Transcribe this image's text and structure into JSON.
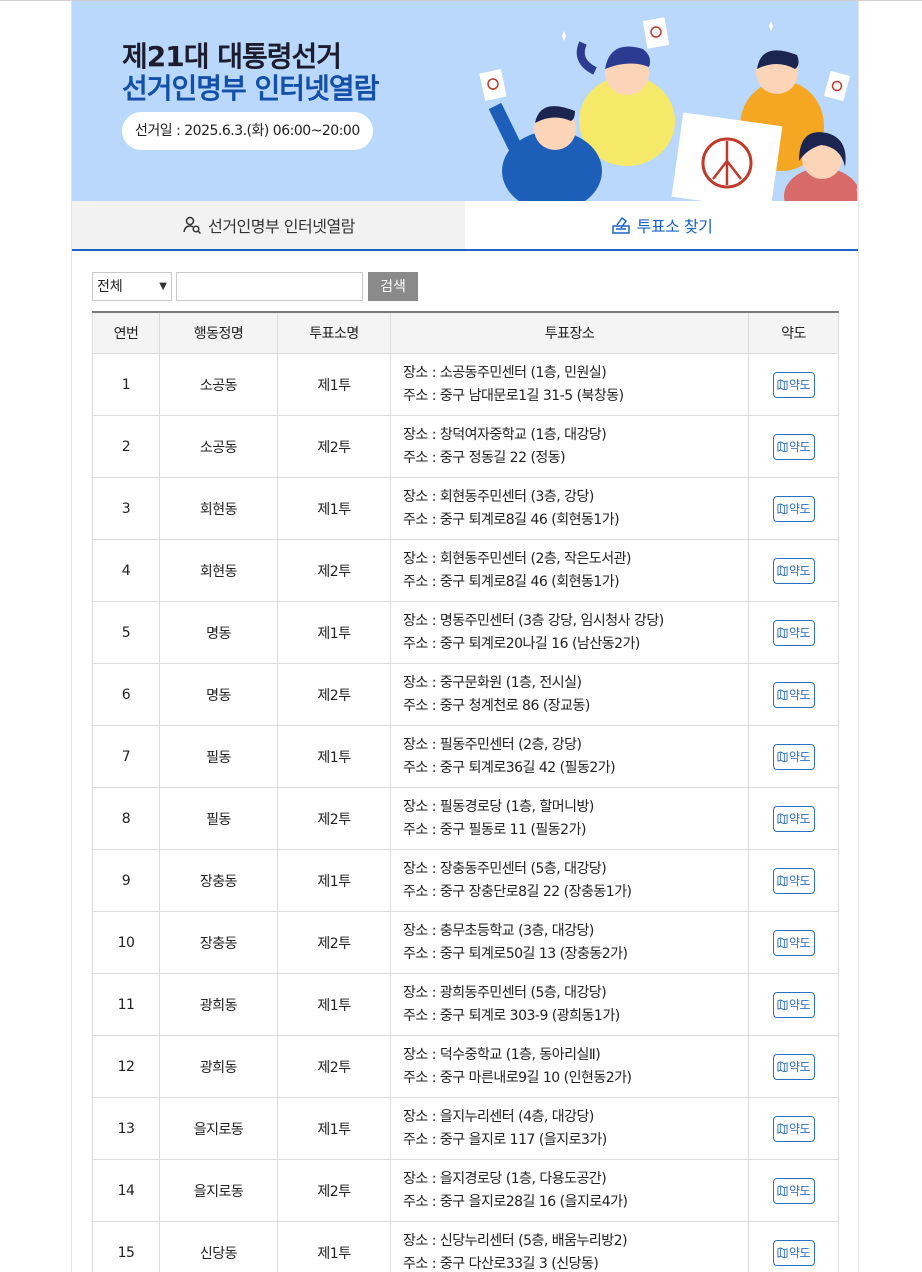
{
  "banner": {
    "title_line1": "제21대 대통령선거",
    "title_line2": "선거인명부 인터넷열람",
    "date": "선거일 : 2025.6.3.(화) 06:00~20:00"
  },
  "tabs": [
    {
      "label": "선거인명부 인터넷열람",
      "icon": "person-search-icon",
      "active": false
    },
    {
      "label": "투표소 찾기",
      "icon": "ballot-box-icon",
      "active": true
    }
  ],
  "search": {
    "select_value": "전체",
    "input_value": "",
    "button_label": "검색"
  },
  "table": {
    "headers": [
      "연번",
      "행동정명",
      "투표소명",
      "투표장소",
      "약도"
    ],
    "map_label": "약도",
    "rows": [
      {
        "no": "1",
        "dong": "소공동",
        "station": "제1투",
        "place": "장소 : 소공동주민센터 (1층, 민원실)",
        "addr": "주소 : 중구 남대문로1길 31-5 (북창동)"
      },
      {
        "no": "2",
        "dong": "소공동",
        "station": "제2투",
        "place": "장소 : 창덕여자중학교 (1층, 대강당)",
        "addr": "주소 : 중구 정동길 22 (정동)"
      },
      {
        "no": "3",
        "dong": "회현동",
        "station": "제1투",
        "place": "장소 : 회현동주민센터 (3층, 강당)",
        "addr": "주소 : 중구 퇴계로8길 46 (회현동1가)"
      },
      {
        "no": "4",
        "dong": "회현동",
        "station": "제2투",
        "place": "장소 : 회현동주민센터 (2층, 작은도서관)",
        "addr": "주소 : 중구 퇴계로8길 46 (회현동1가)"
      },
      {
        "no": "5",
        "dong": "명동",
        "station": "제1투",
        "place": "장소 : 명동주민센터 (3층 강당, 임시청사 강당)",
        "addr": "주소 : 중구 퇴계로20나길 16 (남산동2가)"
      },
      {
        "no": "6",
        "dong": "명동",
        "station": "제2투",
        "place": "장소 : 중구문화원 (1층, 전시실)",
        "addr": "주소 : 중구 청계천로 86 (장교동)"
      },
      {
        "no": "7",
        "dong": "필동",
        "station": "제1투",
        "place": "장소 : 필동주민센터 (2층, 강당)",
        "addr": "주소 : 중구 퇴계로36길 42 (필동2가)"
      },
      {
        "no": "8",
        "dong": "필동",
        "station": "제2투",
        "place": "장소 : 필동경로당 (1층, 할머니방)",
        "addr": "주소 : 중구 필동로 11 (필동2가)"
      },
      {
        "no": "9",
        "dong": "장충동",
        "station": "제1투",
        "place": "장소 : 장충동주민센터 (5층, 대강당)",
        "addr": "주소 : 중구 장충단로8길 22 (장충동1가)"
      },
      {
        "no": "10",
        "dong": "장충동",
        "station": "제2투",
        "place": "장소 : 충무초등학교 (3층, 대강당)",
        "addr": "주소 : 중구 퇴계로50길 13 (장충동2가)"
      },
      {
        "no": "11",
        "dong": "광희동",
        "station": "제1투",
        "place": "장소 : 광희동주민센터 (5층, 대강당)",
        "addr": "주소 : 중구 퇴계로 303-9 (광희동1가)"
      },
      {
        "no": "12",
        "dong": "광희동",
        "station": "제2투",
        "place": "장소 : 덕수중학교 (1층, 동아리실Ⅱ)",
        "addr": "주소 : 중구 마른내로9길 10 (인현동2가)"
      },
      {
        "no": "13",
        "dong": "을지로동",
        "station": "제1투",
        "place": "장소 : 을지누리센터 (4층, 대강당)",
        "addr": "주소 : 중구 을지로 117 (을지로3가)"
      },
      {
        "no": "14",
        "dong": "을지로동",
        "station": "제2투",
        "place": "장소 : 을지경로당 (1층, 다용도공간)",
        "addr": "주소 : 중구 을지로28길 16 (을지로4가)"
      },
      {
        "no": "15",
        "dong": "신당동",
        "station": "제1투",
        "place": "장소 : 신당누리센터 (5층, 배움누리방2)",
        "addr": "주소 : 중구 다산로33길 3 (신당동)"
      }
    ]
  },
  "colors": {
    "banner_bg": "#b9d8fb",
    "accent_blue": "#1b63c6",
    "title_blue": "#1450a8"
  }
}
